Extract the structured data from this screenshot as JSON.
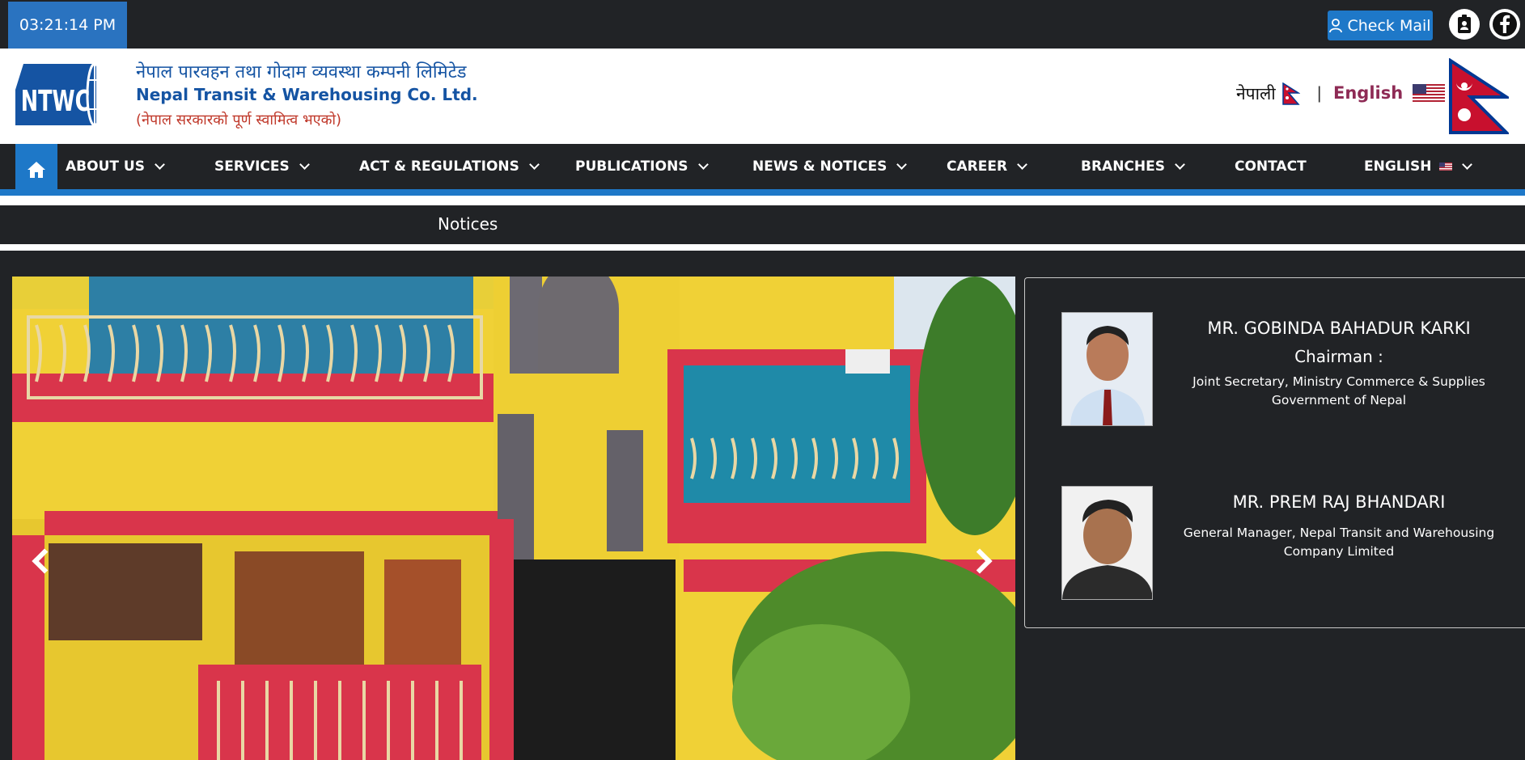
{
  "topbar": {
    "time": "03:21:14 PM",
    "check_mail_label": "Check Mail"
  },
  "brand": {
    "logo_text": "NTWC",
    "name_nepali": "नेपाल पारवहन तथा गोदाम व्यवस्था कम्पनी लिमिटेड",
    "name_english": "Nepal Transit & Warehousing Co. Ltd.",
    "subtitle": "(नेपाल सरकारको पूर्ण स्वामित्व भएको)",
    "lang_nepali": "नेपाली",
    "lang_separator": "|",
    "lang_english": "English"
  },
  "nav": {
    "items": [
      {
        "label": "ABOUT US"
      },
      {
        "label": "SERVICES"
      },
      {
        "label": "ACT & REGULATIONS"
      },
      {
        "label": "PUBLICATIONS"
      },
      {
        "label": "NEWS & NOTICES"
      },
      {
        "label": "CAREER"
      },
      {
        "label": "BRANCHES"
      },
      {
        "label": "CONTACT"
      },
      {
        "label": "ENGLISH"
      }
    ]
  },
  "notices": {
    "label": "Notices"
  },
  "officials": [
    {
      "name": "MR. GOBINDA BAHADUR KARKI",
      "role": "Chairman :",
      "description": "Joint Secretary, Ministry Commerce & Supplies Government of Nepal"
    },
    {
      "name": "MR. PREM RAJ BHANDARI",
      "description": "General Manager, Nepal Transit and Warehousing Company Limited"
    }
  ],
  "colors": {
    "dark_bg": "#212326",
    "accent_blue": "#1e78c8",
    "brand_blue": "#1554a3",
    "subtitle_red": "#c0392b",
    "english_link": "#8e2b55"
  }
}
